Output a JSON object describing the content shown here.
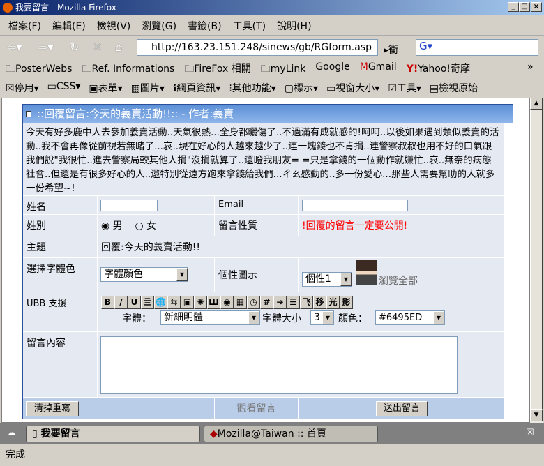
{
  "window": {
    "title": "我要留言 - Mozilla Firefox"
  },
  "menu": [
    "檔案(F)",
    "編輯(E)",
    "檢視(V)",
    "瀏覽(G)",
    "書籤(B)",
    "工具(T)",
    "說明(H)"
  ],
  "nav": {
    "url": "http://163.23.151.248/sinews/gb/RGform.asp",
    "go_label": "衝",
    "search_engine": "G"
  },
  "bookmarks": [
    "PosterWebs",
    "Ref. Informations",
    "FireFox 相關",
    "myLink",
    "Google",
    "Gmail",
    "Yahoo!奇摩"
  ],
  "extensions": [
    "停用",
    "CSS",
    "表單",
    "圖片",
    "網頁資訊",
    "其他功能",
    "標示",
    "視窗大小",
    "工具",
    "檢視原始"
  ],
  "form": {
    "header": "::回覆留言:今天的義賣活動!!:: - 作者:義賣",
    "message": "今天有好多鹿中人去參加義賣活動..天氣很熱...全身都曬傷了..不過滿有成就感的!呵呵..以後如果遇到類似義賣的活動..我不會再像從前視若無睹了...哀..現在好心的人越來越少了..連一塊錢也不肯捐..連警察叔叔也用不好的口氣跟我們說\"我很忙..進去警察局較其他人捐\"沒捐就算了..還瞪我朋友= =只是拿錢的一個動作就嫌忙..哀..無奈的病態社會..但還是有很多好心的人..還特別從遠方跑來拿錢給我們...ㄔㄠ感動的..多一份愛心...那些人需要幫助的人就多一份希望~!",
    "name_label": "姓名",
    "email_label": "Email",
    "gender_label": "姓別",
    "male": "男",
    "female": "女",
    "privacy_label": "留言性質",
    "privacy_notice": "!回覆的留言一定要公開!",
    "subject_label": "主題",
    "subject_value": "回覆:今天的義賣活動!!",
    "font_color_label": "選擇字體色",
    "font_color_value": "字體顏色",
    "avatar_label": "個性圖示",
    "avatar_value": "個性1",
    "browse_all": "瀏覽全部",
    "ubb_label": "UBB 支援",
    "ubb_buttons": [
      "B",
      "/",
      "U",
      "亖",
      "🌐",
      "⇆",
      "▣",
      "✺",
      "Ш",
      "◉",
      "▦",
      "◷",
      "#",
      "➔",
      "☰",
      "飞",
      "移",
      "光",
      "影"
    ],
    "font_label": "字體：",
    "font_value": "新細明體",
    "size_label": "字體大小",
    "size_value": "3",
    "color_label": "顏色：",
    "color_value": "#6495ED",
    "content_label": "留言內容",
    "clear_button": "清掉重寫",
    "view_link": "觀看留言",
    "submit_button": "送出留言"
  },
  "tabs": [
    "我要留言",
    "Mozilla@Taiwan :: 首頁"
  ],
  "status": "完成"
}
